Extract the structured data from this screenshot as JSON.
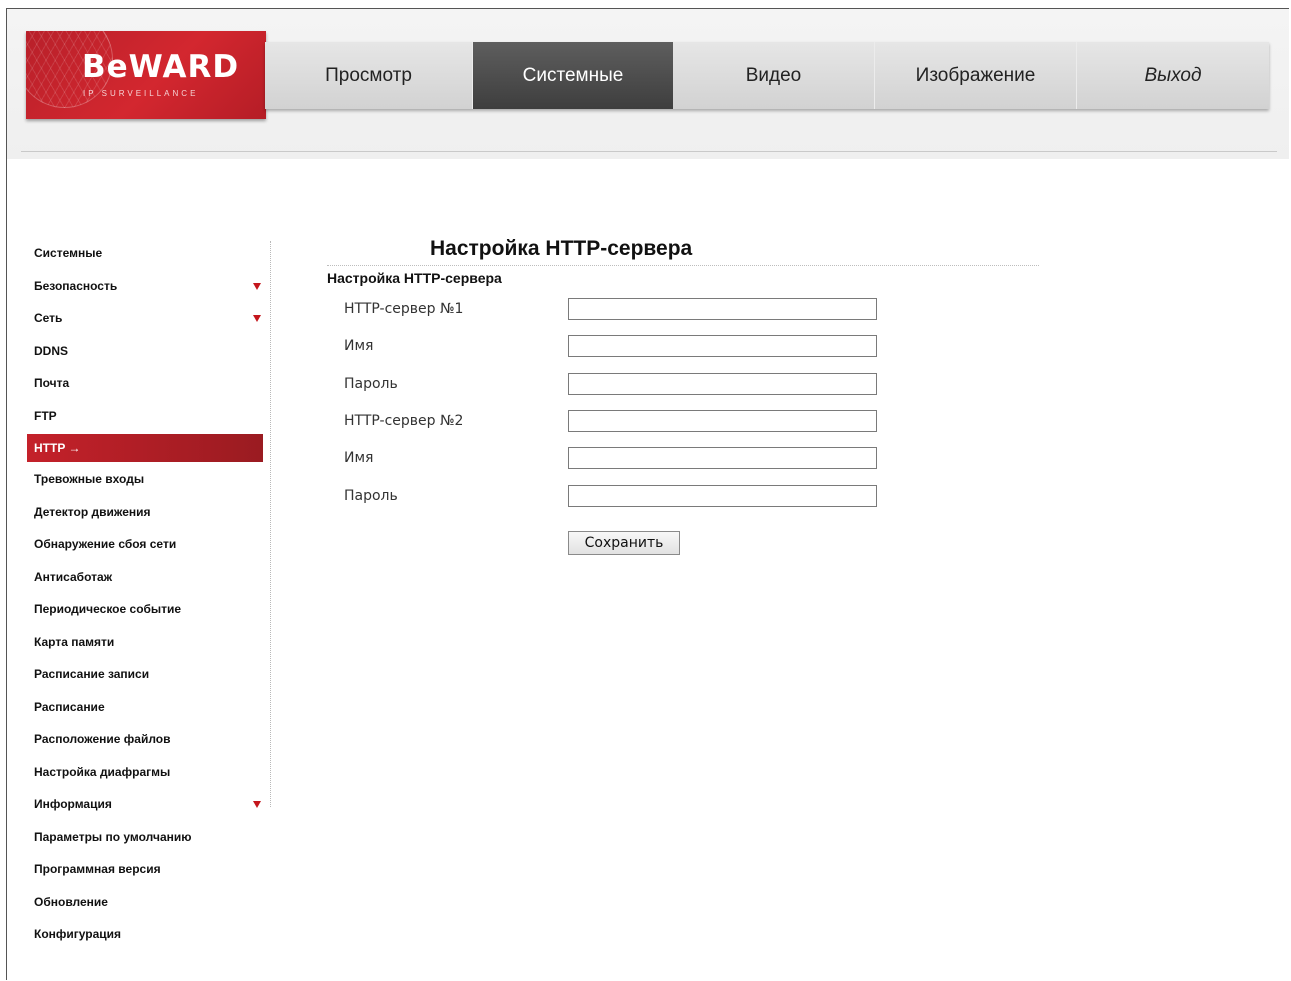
{
  "logo": {
    "text": "BeWARD",
    "subtitle": "IP SURVEILLANCE"
  },
  "nav": {
    "items": [
      {
        "label": "Просмотр"
      },
      {
        "label": "Системные"
      },
      {
        "label": "Видео"
      },
      {
        "label": "Изображение"
      },
      {
        "label": "Выход"
      }
    ],
    "active": "Системные"
  },
  "sidebar": {
    "items": [
      {
        "label": "Системные",
        "has_submenu": false
      },
      {
        "label": "Безопасность",
        "has_submenu": true
      },
      {
        "label": "Сеть",
        "has_submenu": true
      },
      {
        "label": "DDNS",
        "has_submenu": false
      },
      {
        "label": "Почта",
        "has_submenu": false
      },
      {
        "label": "FTP",
        "has_submenu": false
      },
      {
        "label": "HTTP →",
        "has_submenu": false,
        "active": true
      },
      {
        "label": "Тревожные входы",
        "has_submenu": false
      },
      {
        "label": "Детектор движения",
        "has_submenu": false
      },
      {
        "label": "Обнаружение сбоя сети",
        "has_submenu": false
      },
      {
        "label": "Антисаботаж",
        "has_submenu": false
      },
      {
        "label": "Периодическое событие",
        "has_submenu": false
      },
      {
        "label": "Карта памяти",
        "has_submenu": false
      },
      {
        "label": "Расписание записи",
        "has_submenu": false
      },
      {
        "label": "Расписание",
        "has_submenu": false
      },
      {
        "label": "Расположение файлов",
        "has_submenu": false
      },
      {
        "label": "Настройка диафрагмы",
        "has_submenu": false
      },
      {
        "label": "Информация",
        "has_submenu": true
      },
      {
        "label": "Параметры по умолчанию",
        "has_submenu": false
      },
      {
        "label": "Программная версия",
        "has_submenu": false
      },
      {
        "label": "Обновление",
        "has_submenu": false
      },
      {
        "label": "Конфигурация",
        "has_submenu": false
      }
    ]
  },
  "main": {
    "title": "Настройка HTTP-сервера",
    "section_title": "Настройка HTTP-сервера",
    "fields": [
      {
        "label": "HTTP-сервер №1",
        "value": ""
      },
      {
        "label": "Имя",
        "value": ""
      },
      {
        "label": "Пароль",
        "value": ""
      },
      {
        "label": "HTTP-сервер №2",
        "value": ""
      },
      {
        "label": "Имя",
        "value": ""
      },
      {
        "label": "Пароль",
        "value": ""
      }
    ],
    "save_label": "Сохранить"
  },
  "colors": {
    "brand_red": "#c4212a",
    "nav_active": "#4a4a4a",
    "submenu_arrow": "#c4161c"
  }
}
